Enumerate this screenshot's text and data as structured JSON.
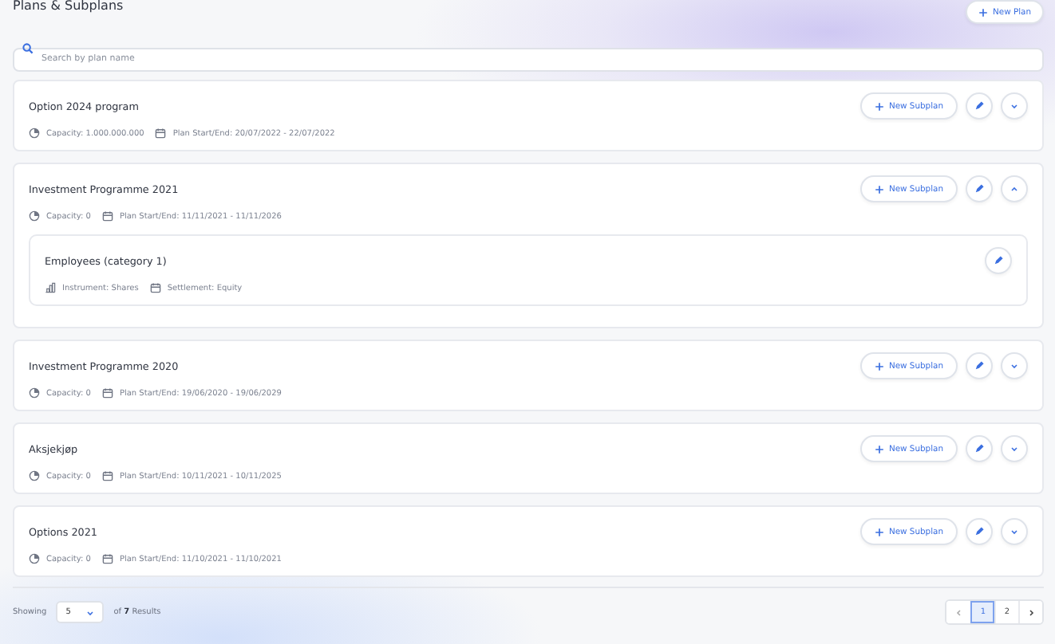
{
  "page_title": "Plans & Subplans",
  "new_plan_button": "New Plan",
  "search": {
    "placeholder": "Search by plan name"
  },
  "plans": [
    {
      "name": "Option 2024 program",
      "capacity": "Capacity: 1.000.000.000",
      "dates": "Plan Start/End: 20/07/2022 - 22/07/2022",
      "new_subplan": "New Subplan",
      "expanded": false
    },
    {
      "name": "Investment Programme 2021",
      "capacity": "Capacity: 0",
      "dates": "Plan Start/End: 11/11/2021 - 11/11/2026",
      "new_subplan": "New Subplan",
      "expanded": true,
      "subplans": [
        {
          "name": "Employees (category 1)",
          "instrument": "Instrument: Shares",
          "settlement": "Settlement: Equity"
        }
      ]
    },
    {
      "name": "Investment Programme 2020",
      "capacity": "Capacity: 0",
      "dates": "Plan Start/End: 19/06/2020 - 19/06/2029",
      "new_subplan": "New Subplan",
      "expanded": false
    },
    {
      "name": "Aksjekjøp",
      "capacity": "Capacity: 0",
      "dates": "Plan Start/End: 10/11/2021 - 10/11/2025",
      "new_subplan": "New Subplan",
      "expanded": false
    },
    {
      "name": "Options 2021",
      "capacity": "Capacity: 0",
      "dates": "Plan Start/End: 11/10/2021 - 11/10/2021",
      "new_subplan": "New Subplan",
      "expanded": false
    }
  ],
  "footer": {
    "showing_label": "Showing",
    "page_size": "5",
    "results": "of **7** Results",
    "pages": [
      {
        "label": "1",
        "selected": true
      },
      {
        "label": "2",
        "selected": false
      }
    ]
  }
}
